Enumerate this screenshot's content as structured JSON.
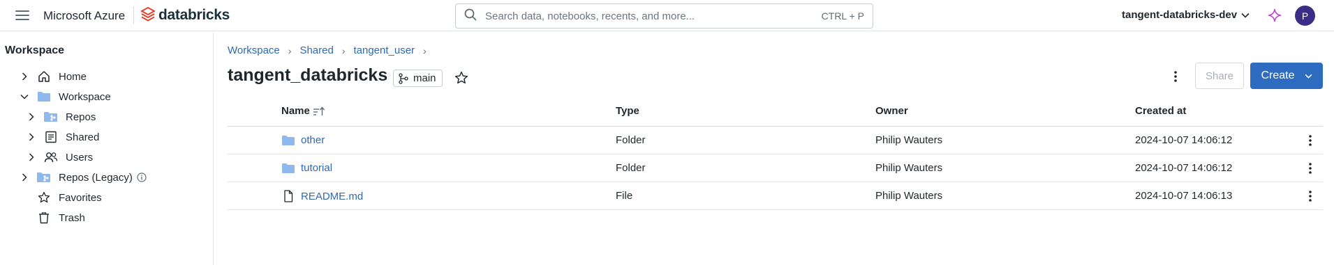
{
  "header": {
    "azure_label": "Microsoft Azure",
    "brand_label": "databricks",
    "search_placeholder": "Search data, notebooks, recents, and more...",
    "search_shortcut": "CTRL + P",
    "workspace_name": "tangent-databricks-dev",
    "avatar_initial": "P"
  },
  "sidebar": {
    "title": "Workspace",
    "items": [
      {
        "label": "Home",
        "icon": "home-icon"
      },
      {
        "label": "Workspace",
        "icon": "folder-icon"
      },
      {
        "label": "Repos",
        "icon": "repo-folder-icon"
      },
      {
        "label": "Shared",
        "icon": "shared-icon"
      },
      {
        "label": "Users",
        "icon": "users-icon"
      },
      {
        "label": "Repos (Legacy)",
        "icon": "repo-folder-icon"
      },
      {
        "label": "Favorites",
        "icon": "star-icon"
      },
      {
        "label": "Trash",
        "icon": "trash-icon"
      }
    ]
  },
  "breadcrumb": [
    "Workspace",
    "Shared",
    "tangent_user"
  ],
  "page": {
    "title": "tangent_databricks",
    "branch": "main",
    "share_label": "Share",
    "create_label": "Create"
  },
  "table": {
    "columns": [
      "Name",
      "Type",
      "Owner",
      "Created at"
    ],
    "rows": [
      {
        "name": "other",
        "type": "Folder",
        "owner": "Philip Wauters",
        "created": "2024-10-07 14:06:12",
        "icon": "folder-icon"
      },
      {
        "name": "tutorial",
        "type": "Folder",
        "owner": "Philip Wauters",
        "created": "2024-10-07 14:06:12",
        "icon": "folder-icon"
      },
      {
        "name": "README.md",
        "type": "File",
        "owner": "Philip Wauters",
        "created": "2024-10-07 14:06:13",
        "icon": "file-icon"
      }
    ]
  },
  "colors": {
    "accent": "#2d6cc0",
    "link": "#2f69b3",
    "folder": "#8fb8ec",
    "avatar": "#3b2c85",
    "sparkle": "#c23ed4"
  }
}
